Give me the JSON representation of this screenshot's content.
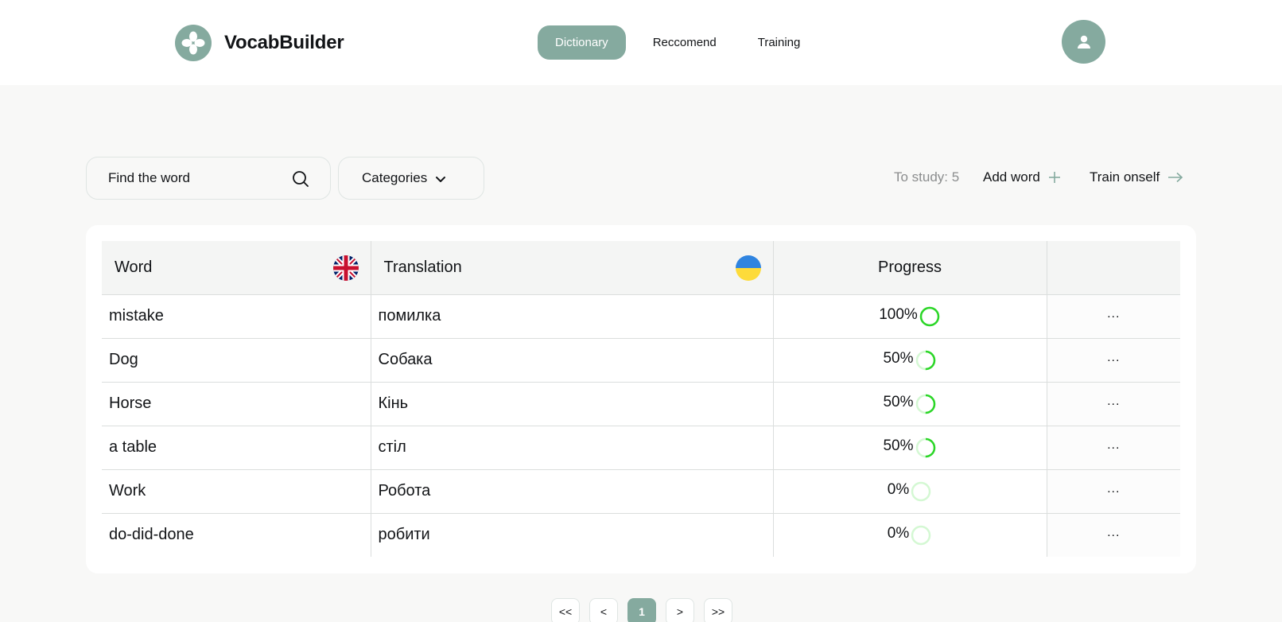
{
  "app": {
    "name": "VocabBuilder"
  },
  "nav": [
    {
      "label": "Dictionary",
      "active": true
    },
    {
      "label": "Reccomend",
      "active": false
    },
    {
      "label": "Training",
      "active": false
    }
  ],
  "toolbar": {
    "search_placeholder": "Find the word",
    "categories_label": "Categories",
    "to_study": "To study: 5",
    "add_word": "Add word",
    "train": "Train onself"
  },
  "table": {
    "headers": {
      "word": "Word",
      "translation": "Translation",
      "progress": "Progress"
    },
    "rows": [
      {
        "word": "mistake",
        "translation": "помилка",
        "progress": "100%",
        "progress_value": 1.0
      },
      {
        "word": "Dog",
        "translation": "Собака",
        "progress": "50%",
        "progress_value": 0.5
      },
      {
        "word": "Horse",
        "translation": "Кінь",
        "progress": "50%",
        "progress_value": 0.5
      },
      {
        "word": "a table",
        "translation": "стіл",
        "progress": "50%",
        "progress_value": 0.5
      },
      {
        "word": "Work",
        "translation": "Робота",
        "progress": "0%",
        "progress_value": 0.0
      },
      {
        "word": "do-did-done",
        "translation": "робити",
        "progress": "0%",
        "progress_value": 0.0
      }
    ],
    "row_action": "..."
  },
  "pagination": {
    "first": "<<",
    "prev": "<",
    "current": "1",
    "next": ">",
    "last": ">>"
  },
  "colors": {
    "accent": "#85aa9f",
    "progress": "#2bd627",
    "progress_track": "#d4f8d3"
  },
  "icons": {
    "logo": "logo-icon",
    "user": "user-icon",
    "search": "search-icon",
    "chevron": "chevron-down-icon",
    "plus": "plus-icon",
    "arrow": "arrow-right-icon",
    "uk_flag": "uk-flag-icon",
    "ua_flag": "ua-flag-icon"
  }
}
